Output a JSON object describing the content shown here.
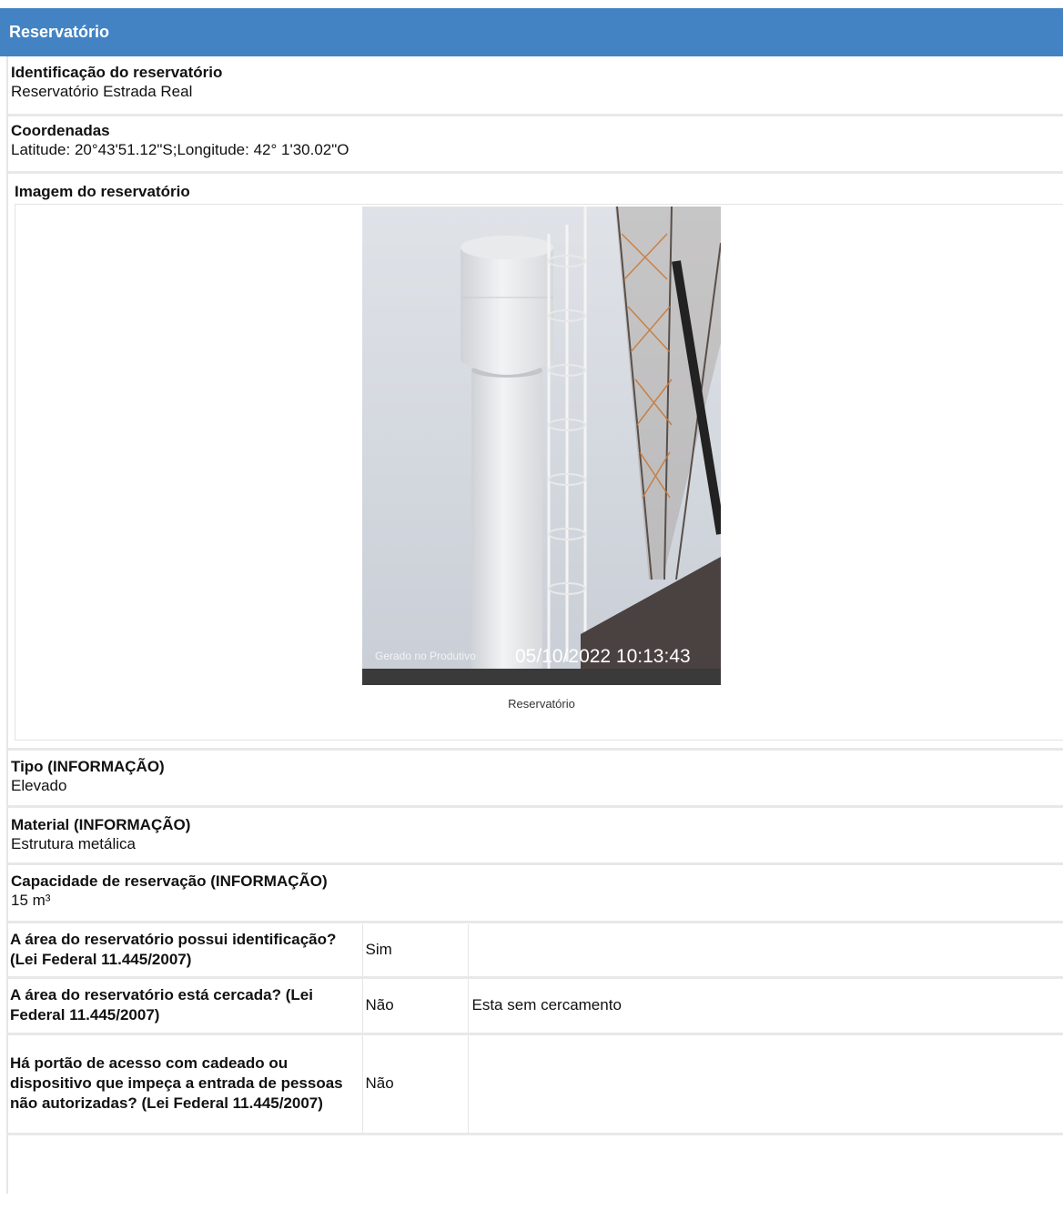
{
  "section_title": "Reservatório",
  "fields": {
    "identificacao": {
      "label": "Identificação do reservatório",
      "value": "Reservatório Estrada Real"
    },
    "coordenadas": {
      "label": "Coordenadas",
      "value": "Latitude: 20°43'51.12\"S;Longitude: 42° 1'30.02\"O"
    },
    "tipo": {
      "label": "Tipo (INFORMAÇÃO)",
      "value": "Elevado"
    },
    "material": {
      "label": "Material (INFORMAÇÃO)",
      "value": "Estrutura metálica"
    },
    "capacidade": {
      "label": "Capacidade de reservação (INFORMAÇÃO)",
      "value": "15 m³"
    }
  },
  "image_section": {
    "label": "Imagem do reservatório",
    "photo_watermark_left": "Gerado no Produtivo",
    "photo_timestamp": "05/10/2022 10:13:43",
    "caption": "Reservatório"
  },
  "questions": [
    {
      "question": "A área do reservatório possui identificação? (Lei Federal 11.445/2007)",
      "answer": "Sim",
      "note": ""
    },
    {
      "question": "A área do reservatório está cercada? (Lei Federal 11.445/2007)",
      "answer": "Não",
      "note": "Esta sem cercamento"
    },
    {
      "question": "Há portão de acesso com cadeado ou dispositivo que impeça a entrada de pessoas não autorizadas? (Lei Federal 11.445/2007)",
      "answer": "Não",
      "note": ""
    }
  ]
}
